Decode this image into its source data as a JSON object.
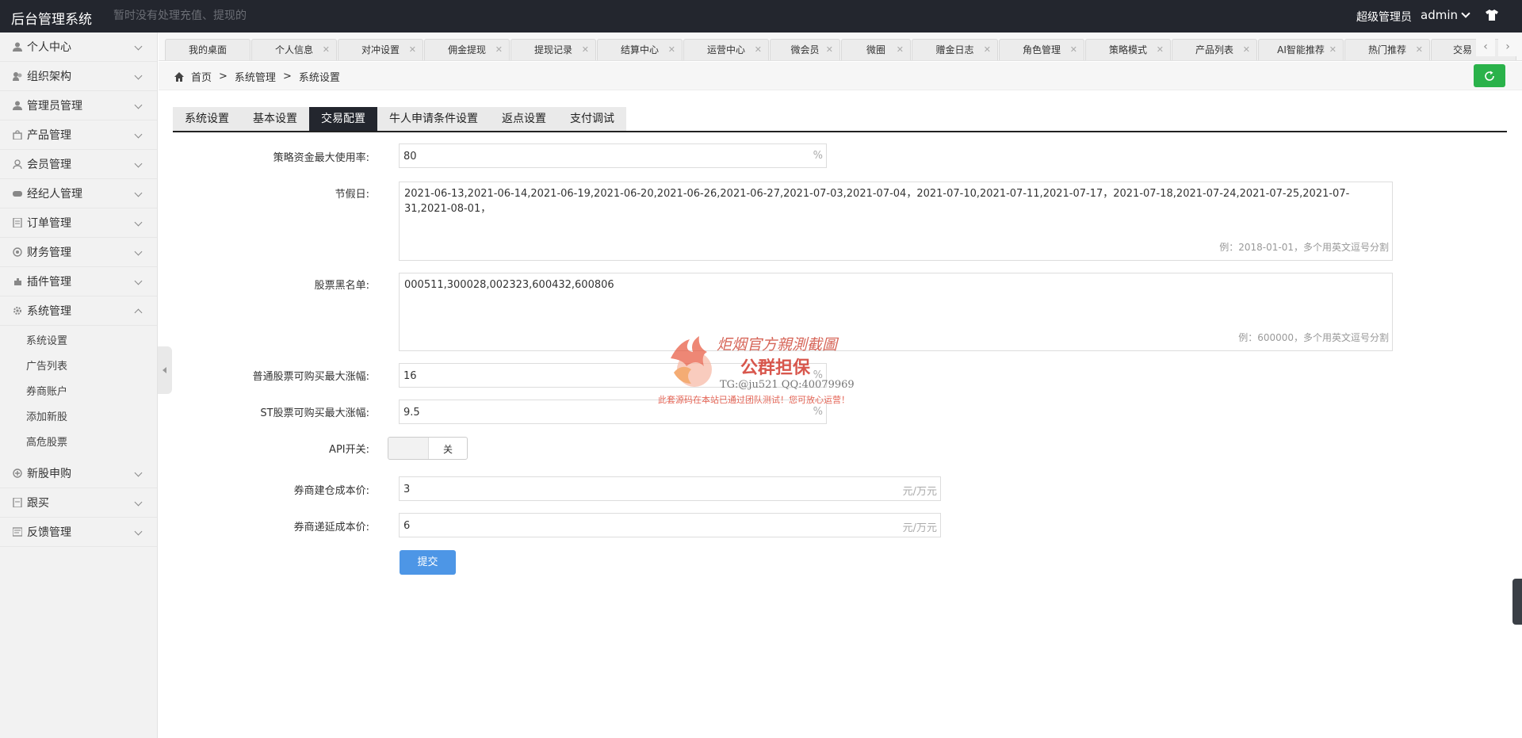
{
  "header": {
    "app_title": "后台管理系统",
    "notice": "暂时没有处理充值、提现的",
    "role": "超级管理员",
    "user": "admin"
  },
  "sidebar": {
    "items": [
      {
        "label": "个人中心",
        "icon": "user-icon"
      },
      {
        "label": "组织架构",
        "icon": "org-icon"
      },
      {
        "label": "管理员管理",
        "icon": "admin-icon"
      },
      {
        "label": "产品管理",
        "icon": "bag-icon"
      },
      {
        "label": "会员管理",
        "icon": "member-icon"
      },
      {
        "label": "经纪人管理",
        "icon": "agent-icon"
      },
      {
        "label": "订单管理",
        "icon": "order-icon"
      },
      {
        "label": "财务管理",
        "icon": "finance-icon"
      },
      {
        "label": "插件管理",
        "icon": "plugin-icon"
      },
      {
        "label": "系统管理",
        "icon": "gear-icon"
      },
      {
        "label": "新股申购",
        "icon": "ipo-icon"
      },
      {
        "label": "跟买",
        "icon": "follow-icon"
      },
      {
        "label": "反馈管理",
        "icon": "feedback-icon"
      }
    ],
    "submenu": [
      "系统设置",
      "广告列表",
      "券商账户",
      "添加新股",
      "高危股票"
    ]
  },
  "tabs": [
    "我的桌面",
    "个人信息",
    "对冲设置",
    "佣金提现",
    "提现记录",
    "结算中心",
    "运营中心",
    "微会员",
    "微圈",
    "赠金日志",
    "角色管理",
    "策略模式",
    "产品列表",
    "AI智能推荐",
    "热门推荐",
    "交易"
  ],
  "breadcrumb": [
    "首页",
    "系统管理",
    "系统设置"
  ],
  "breadcrumb_sep": ">",
  "subtabs": [
    "系统设置",
    "基本设置",
    "交易配置",
    "牛人申请条件设置",
    "返点设置",
    "支付调试"
  ],
  "active_subtab": "交易配置",
  "form": {
    "max_usage_label": "策略资金最大使用率:",
    "max_usage_value": "80",
    "percent_unit": "%",
    "holidays_label": "节假日:",
    "holidays_value": "2021-06-13,2021-06-14,2021-06-19,2021-06-20,2021-06-26,2021-06-27,2021-07-03,2021-07-04，2021-07-10,2021-07-11,2021-07-17，2021-07-18,2021-07-24,2021-07-25,2021-07-31,2021-08-01，",
    "holidays_hint": "例：2018-01-01，多个用英文逗号分割",
    "blacklist_label": "股票黑名单:",
    "blacklist_value": "000511,300028,002323,600432,600806",
    "blacklist_hint": "例：600000，多个用英文逗号分割",
    "normal_rise_label": "普通股票可购买最大涨幅:",
    "normal_rise_value": "16",
    "st_rise_label": "ST股票可购买最大涨幅:",
    "st_rise_value": "9.5",
    "api_label": "API开关:",
    "api_state": "关",
    "open_cost_label": "券商建仓成本价:",
    "open_cost_value": "3",
    "defer_cost_label": "券商递延成本价:",
    "defer_cost_value": "6",
    "cost_unit": "元/万元",
    "submit_label": "提交"
  },
  "watermark": {
    "line1": "炬烟官方親測截圖",
    "line2": "公群担保",
    "line3": "TG:@ju521   QQ:40079969",
    "line4": "此套源码在本站已通过团队测试！您可放心运营！"
  },
  "colors": {
    "header_bg": "#23262e",
    "active_tab_bg": "#23262e",
    "refresh_green": "#2ab24a",
    "submit_blue": "#4d96e6"
  }
}
